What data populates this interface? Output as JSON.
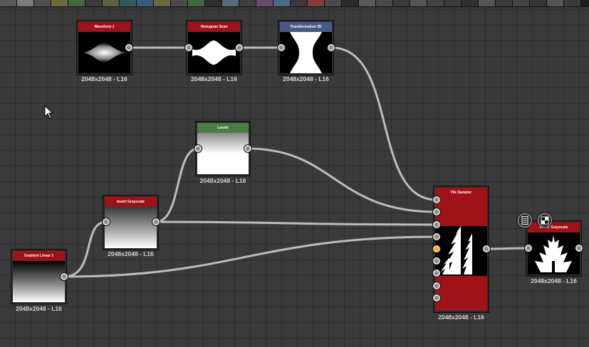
{
  "toolbar": {
    "swatch_colors": [
      "#5a5a5a",
      "#7a7a7a",
      "#4f4f4f",
      "#6b6b3a",
      "#3f6b3f",
      "#3b3b3b",
      "#5f5f3f",
      "#2f5a5a",
      "#3b5a7a",
      "#6a6a3a",
      "#4a4a4a",
      "#3c6a3c",
      "#2f2f2f",
      "#5a6a7a",
      "#3e3e3e",
      "#6a4a6a",
      "#4a6a8a",
      "#3a3a3a",
      "#8a3a3a",
      "#4a4a4a",
      "#2a2a2a",
      "#5a5a5a",
      "#4a4a4a",
      "#3a3a3a",
      "#555555",
      "#444444",
      "#3b3b3b",
      "#2f2f2f",
      "#555555",
      "#3c3c3c",
      "#444444",
      "#333333",
      "#555555",
      "#3a3a3a"
    ]
  },
  "colors": {
    "canvas": "#3a3a3a",
    "header_red": "#9e1218",
    "header_green": "#4b7d4a",
    "header_blue": "#4a5a86",
    "wire": "#bdbdbd"
  },
  "nodes": {
    "waveform": {
      "title": "Waveform 1",
      "size": "2048x2048 - L16",
      "header_color": "#9e1218"
    },
    "histogram_scan": {
      "title": "Histogram Scan",
      "size": "2048x2048 - L16",
      "header_color": "#9e1218"
    },
    "transformation_2d": {
      "title": "Transformation 2D",
      "size": "2048x2048 - L16",
      "header_color": "#4a5a86"
    },
    "levels": {
      "title": "Levels",
      "size": "2048x2048 - L16",
      "header_color": "#4b7d4a"
    },
    "invert_grayscale": {
      "title": "Invert Grayscale",
      "size": "2048x2048 - L16",
      "header_color": "#9e1218"
    },
    "gradient_linear": {
      "title": "Gradient Linear 1",
      "size": "2048x2048 - L16",
      "header_color": "#9e1218"
    },
    "tile_sampler": {
      "title": "Tile Sampler",
      "size": "2048x2048 - L16",
      "header_color": "#9e1218"
    },
    "mirror_grayscale": {
      "title": "Mirror Grayscale",
      "size": "2048x2048 - L16",
      "header_color": "#9e1218"
    }
  },
  "context_icons": [
    "document-icon",
    "checker-icon"
  ]
}
